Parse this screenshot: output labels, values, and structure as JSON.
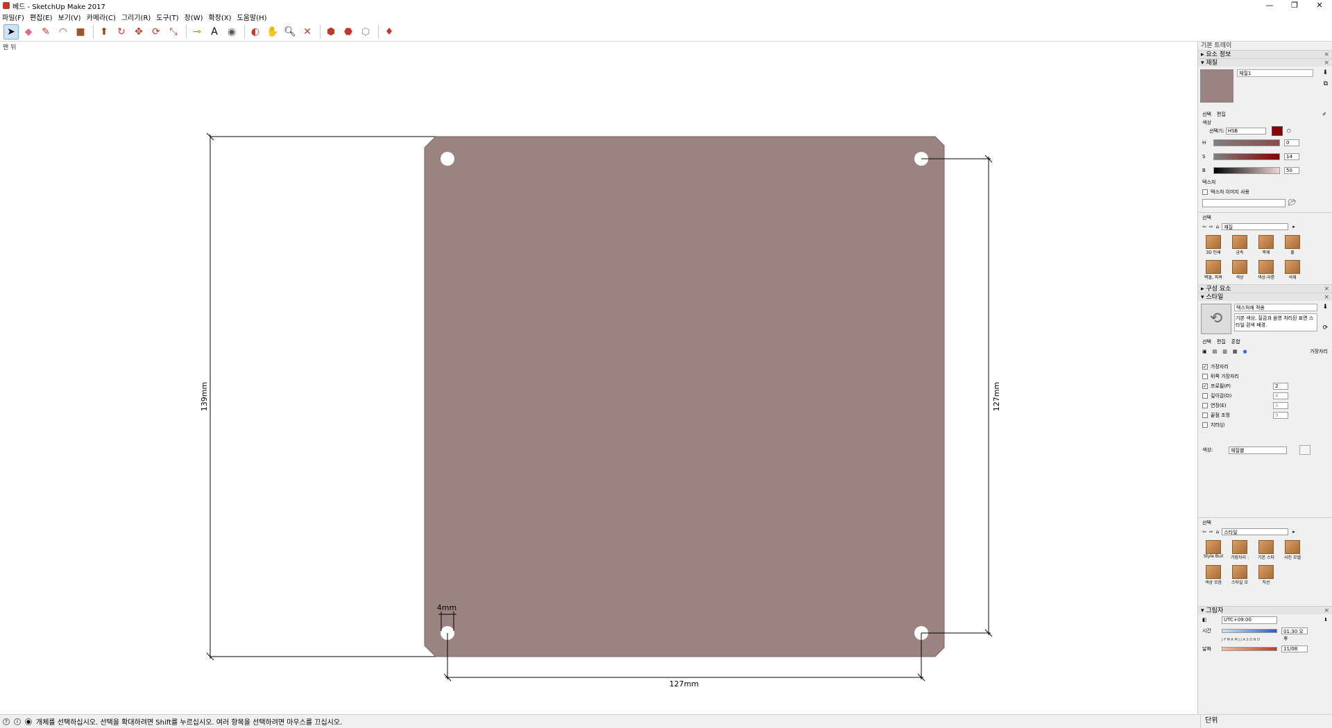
{
  "window": {
    "title": "베드 - SketchUp Make 2017",
    "minimize": "—",
    "restore": "❐",
    "close": "✕"
  },
  "menu": [
    "파일(F)",
    "편집(E)",
    "보기(V)",
    "카메라(C)",
    "그리기(R)",
    "도구(T)",
    "창(W)",
    "확장(X)",
    "도움말(H)"
  ],
  "scene_label": "맨 뒤",
  "model": {
    "plate_color": "#9a8381",
    "dim_left": "139mm",
    "dim_right": "127mm",
    "dim_bottom": "127mm",
    "dim_hole": "4mm"
  },
  "tray": {
    "title": "기본 트레이",
    "entity_info": "요소 정보",
    "materials": {
      "header": "재질",
      "name": "재질1",
      "tab_select": "선택",
      "tab_edit": "편집",
      "color_label": "색상",
      "picker_label": "선택기:",
      "picker_value": "HSB",
      "h_label": "H",
      "h_value": "0",
      "s_label": "S",
      "s_value": "14",
      "b_label": "B",
      "b_value": "50",
      "texture_label": "텍스처",
      "texture_use": "텍스처 이미지 사용",
      "select_label": "선택",
      "library": "재질",
      "items": [
        "3D 인쇄",
        "금속",
        "목재",
        "물",
        "벽돌, 피복",
        "색상",
        "색상-이름",
        "석재"
      ]
    },
    "components": "구성 요소",
    "styles": {
      "header": "스타일",
      "name": "텍스처에 적용",
      "desc": "기본 색상, 질감과 음영 처리된 표면 스타일 흰색 배경.",
      "tab_select": "선택",
      "tab_edit": "편집",
      "tab_mix": "혼합",
      "edge_label": "가장자리",
      "opt_edges": "가장자리",
      "opt_back_edges": "뒤쪽 가장자리",
      "opt_profiles": "프로필(P)",
      "opt_profiles_val": "2",
      "opt_depth": "깊이감(D)",
      "opt_depth_val": "4",
      "opt_extension": "연장(E)",
      "opt_extension_val": "3",
      "opt_endpoints": "끝점 조정",
      "opt_endpoints_val": "9",
      "opt_jitter": "지터(J)",
      "color_label": "색상:",
      "color_value": "재질별",
      "select_label": "선택",
      "library": "스타일",
      "items": [
        "Style Buil",
        "가장자리 :",
        "기본 스타",
        "사진 모델",
        "색상 모음",
        "스타일 모",
        "직선"
      ]
    },
    "shadows": {
      "header": "그림자",
      "timezone": "UTC+09:00",
      "time_label": "시간",
      "time_value": "01:30 오후",
      "date_label": "날짜",
      "date_value": "11/08",
      "months": "J F M A M J J A S O N D"
    }
  },
  "status": {
    "message": "개체를 선택하십시오. 선택을 확대하려면 Shift를 누르십시오. 여러 항목을 선택하려면 마우스를 끄십시오.",
    "units_label": "단위"
  }
}
